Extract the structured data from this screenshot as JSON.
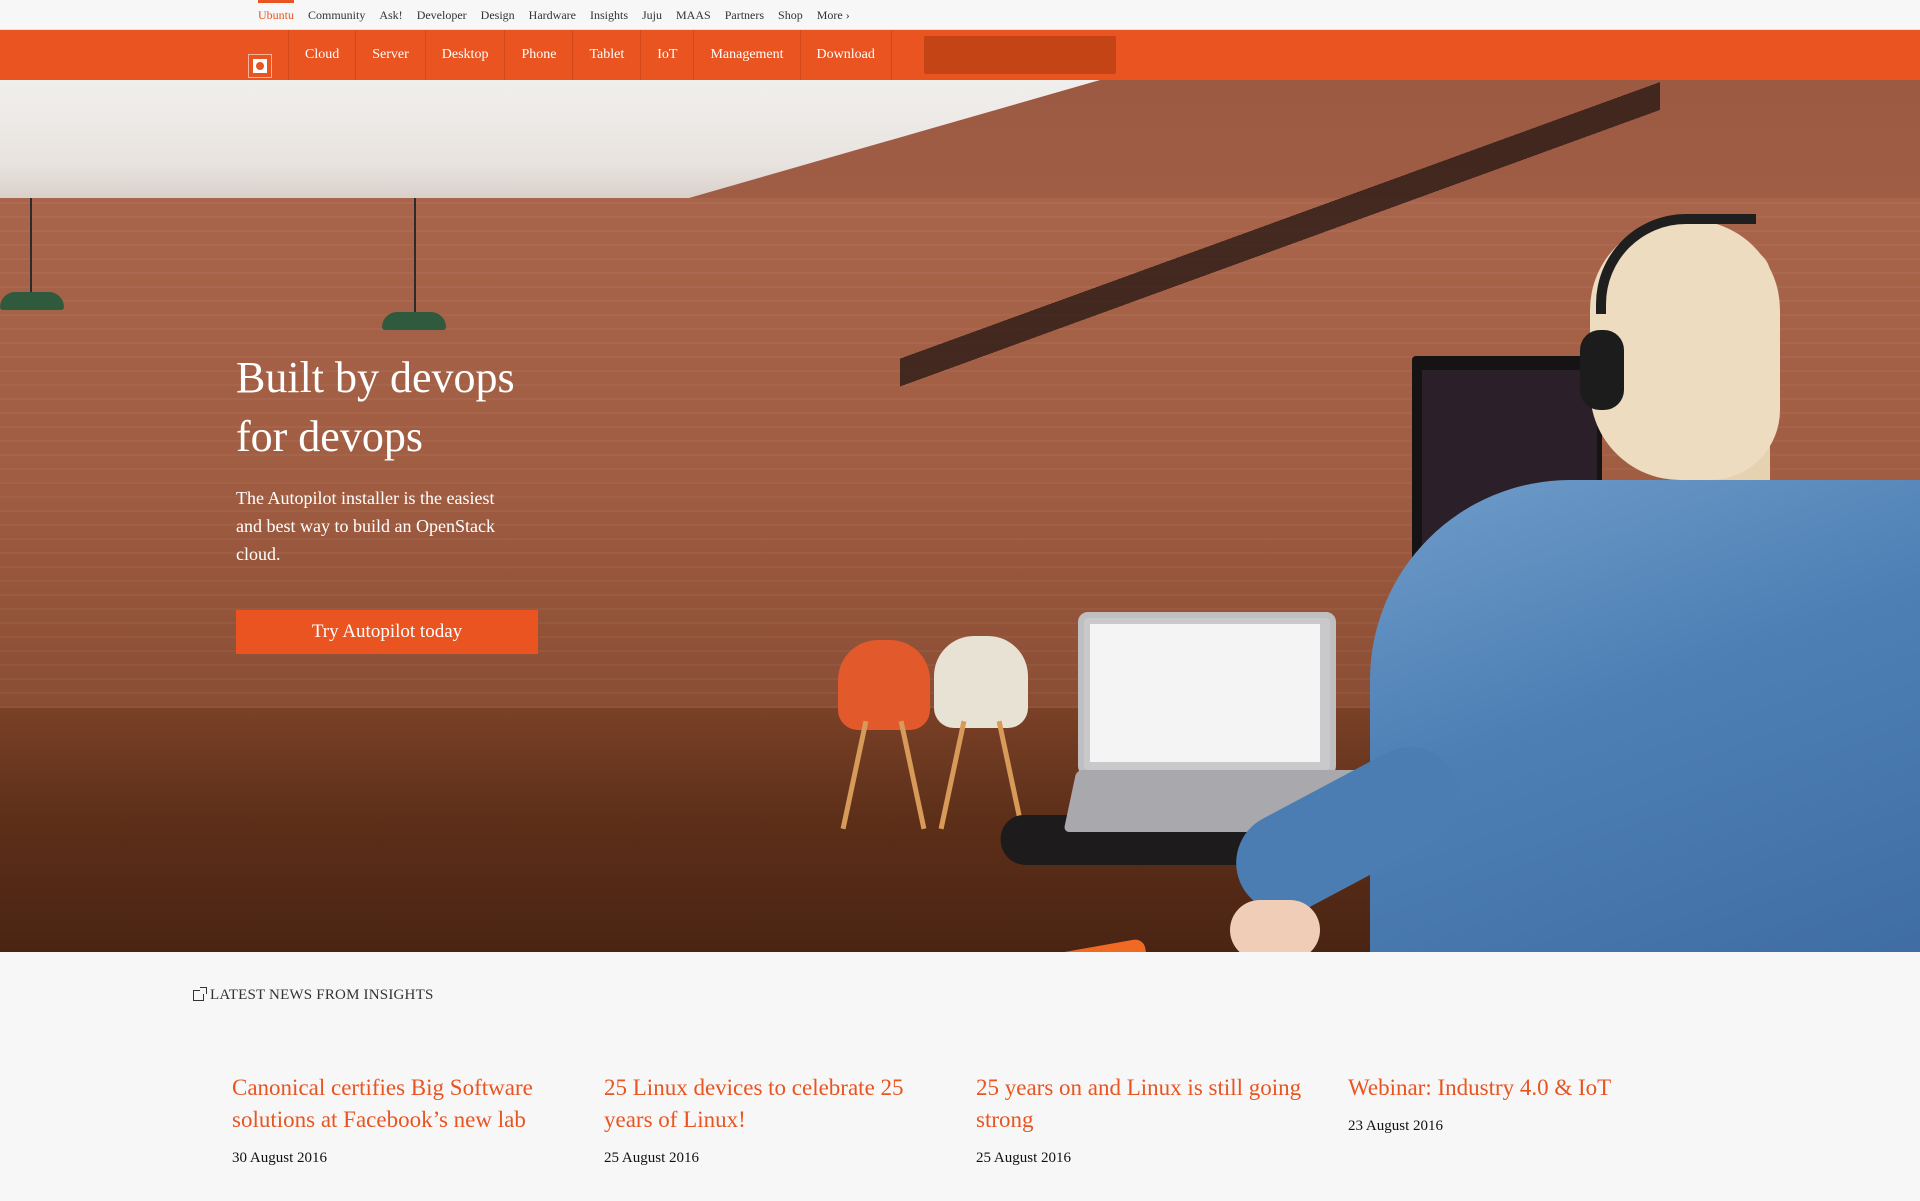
{
  "global_nav": {
    "items": [
      "Ubuntu",
      "Community",
      "Ask!",
      "Developer",
      "Design",
      "Hardware",
      "Insights",
      "Juju",
      "MAAS",
      "Partners",
      "Shop",
      "More ›"
    ]
  },
  "main_nav": {
    "items": [
      "Cloud",
      "Server",
      "Desktop",
      "Phone",
      "Tablet",
      "IoT",
      "Management",
      "Download"
    ],
    "search_value": ""
  },
  "hero": {
    "title_line1": "Built by devops",
    "title_line2": "for devops",
    "text_line1": "The Autopilot installer is the easiest",
    "text_line2": "and best way to build an OpenStack",
    "text_line3": "cloud.",
    "cta_label": "Try Autopilot today"
  },
  "news": {
    "heading": "LATEST NEWS FROM INSIGHTS",
    "items": [
      {
        "title": "Canonical certifies Big Software solutions at Facebook’s new lab",
        "date": "30 August 2016"
      },
      {
        "title": "25 Linux devices to celebrate 25 years of Linux!",
        "date": "25 August 2016"
      },
      {
        "title": "25 years on and Linux is still going strong",
        "date": "25 August 2016"
      },
      {
        "title": "Webinar: Industry 4.0 & IoT",
        "date": "23 August 2016"
      }
    ]
  },
  "colors": {
    "brand_orange": "#e95420",
    "search_bg": "#c54416",
    "news_bg": "#f7f7f7"
  }
}
